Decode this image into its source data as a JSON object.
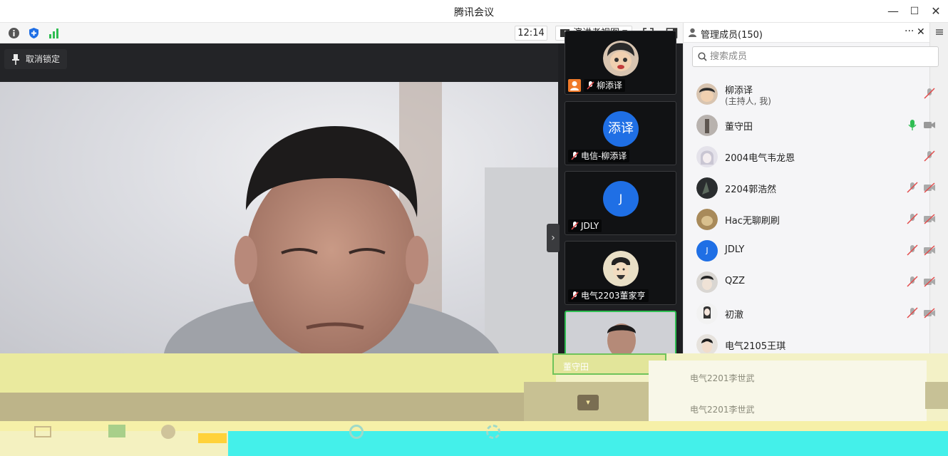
{
  "window": {
    "title": "腾讯会议",
    "minimize": "—",
    "maximize": "☐",
    "close": "✕"
  },
  "toolbar": {
    "time": "12:14",
    "view_mode": "演讲者视图",
    "caret": "▼",
    "signal_color": "#2fbd52",
    "shield_color": "#1f6fe5"
  },
  "stage": {
    "unlock_label": "取消锁定",
    "collapse_glyph": "›"
  },
  "filmstrip": [
    {
      "name": "柳添译",
      "avatar": "cartoon-avatar",
      "badge": "host-icon"
    },
    {
      "name": "电信-柳添译",
      "avatar_text": "添译",
      "avatar_color": "#1f6fe5"
    },
    {
      "name": "JDLY",
      "avatar_text": "J",
      "avatar_color": "#1f6fe5"
    },
    {
      "name": "电气2203董家亨",
      "avatar": "portrait-painting-avatar"
    }
  ],
  "panel": {
    "title": "管理成员(150)",
    "more": "···",
    "close": "✕",
    "search_placeholder": "搜索成员"
  },
  "members": [
    {
      "name": "柳添译",
      "sub": "(主持人, 我)",
      "mic": "muted",
      "cam": "none"
    },
    {
      "name": "董守田",
      "sub": "",
      "mic": "on",
      "cam": "off"
    },
    {
      "name": "2004电气韦龙恩",
      "sub": "",
      "mic": "muted",
      "cam": "none"
    },
    {
      "name": "2204郭浩然",
      "sub": "",
      "mic": "muted",
      "cam": "muted"
    },
    {
      "name": "Hac无聊刷刷",
      "sub": "",
      "mic": "muted",
      "cam": "muted"
    },
    {
      "name": "JDLY",
      "sub": "",
      "mic": "muted",
      "cam": "muted",
      "avatar_text": "J"
    },
    {
      "name": "QZZ",
      "sub": "",
      "mic": "muted",
      "cam": "muted"
    },
    {
      "name": "初澈",
      "sub": "",
      "mic": "muted",
      "cam": "muted"
    },
    {
      "name": "电气2105王琪",
      "sub": "",
      "mic": "muted",
      "cam": "muted"
    }
  ],
  "bottom": {
    "rows": [
      "电气2201李世武",
      "电气2201李世武"
    ],
    "speaker_name": "董守田"
  }
}
